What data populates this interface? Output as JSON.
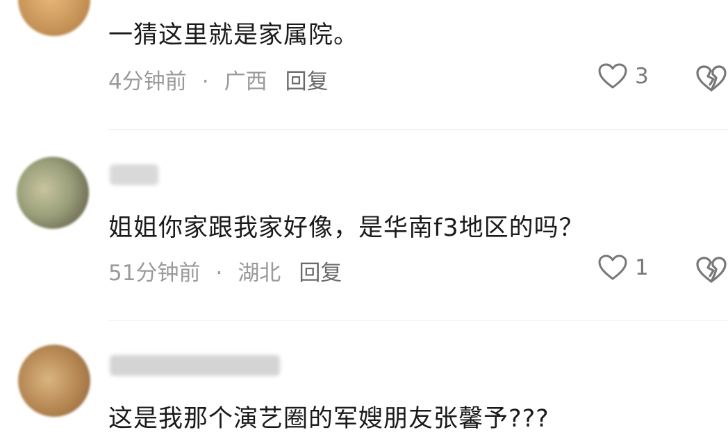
{
  "comments": [
    {
      "text": "一猜这里就是家属院。",
      "time": "4分钟前",
      "separator": "·",
      "location": "广西",
      "reply_label": "回复",
      "likes": "3",
      "avatar_color": "#c9965a"
    },
    {
      "text": "姐姐你家跟我家好像，是华南f3地区的吗？",
      "time": "51分钟前",
      "separator": "·",
      "location": "湖北",
      "reply_label": "回复",
      "likes": "1",
      "avatar_color": "#9aa07a"
    },
    {
      "text": "这是我那个演艺圈的军嫂朋友张馨予???",
      "avatar_color": "#b88a55"
    }
  ],
  "colors": {
    "text": "#1a1a1a",
    "meta": "#9a9a9a",
    "reply": "#6a6a6a",
    "icon": "#777777"
  },
  "icons": {
    "like": "heart-outline-icon",
    "dislike": "broken-heart-icon"
  }
}
